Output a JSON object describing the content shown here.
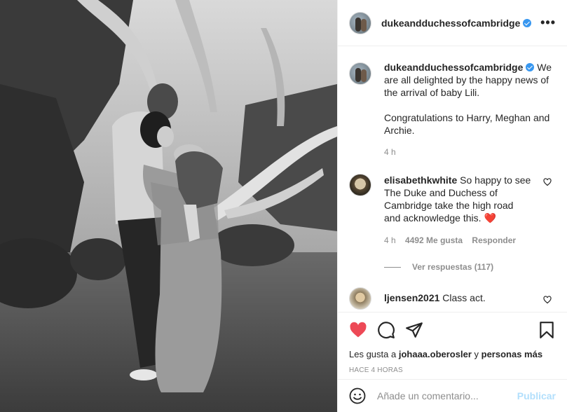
{
  "post": {
    "username": "dukeandduchessofcambridge",
    "more_label": "•••"
  },
  "caption": {
    "username": "dukeandduchessofcambridge",
    "text1": "We are all delighted by the happy news of the arrival of baby Lili.",
    "text2": "Congratulations to Harry, Meghan and Archie.",
    "time": "4 h"
  },
  "comments": [
    {
      "username": "elisabethkwhite",
      "text": "So happy to see The Duke and Duchess of Cambridge take the high road and acknowledge this.",
      "emoji": "❤️",
      "time": "4 h",
      "likes": "4492 Me gusta",
      "reply": "Responder",
      "view_replies": "Ver respuestas (117)"
    },
    {
      "username": "ljensen2021",
      "text": "Class act."
    }
  ],
  "likes": {
    "prefix": "Les gusta a",
    "user": "johaaa.oberosler",
    "connector": "y",
    "rest": "personas más"
  },
  "posted_ago": "HACE 4 HORAS",
  "add_comment": {
    "placeholder": "Añade un comentario...",
    "publish": "Publicar"
  },
  "colors": {
    "liked_heart": "#ed4956",
    "verified": "#3897f0",
    "publish_disabled": "#b2dffc"
  },
  "icons": [
    "verified-badge-icon",
    "more-options-icon",
    "heart-icon",
    "comment-icon",
    "share-icon",
    "bookmark-icon",
    "emoji-icon"
  ]
}
